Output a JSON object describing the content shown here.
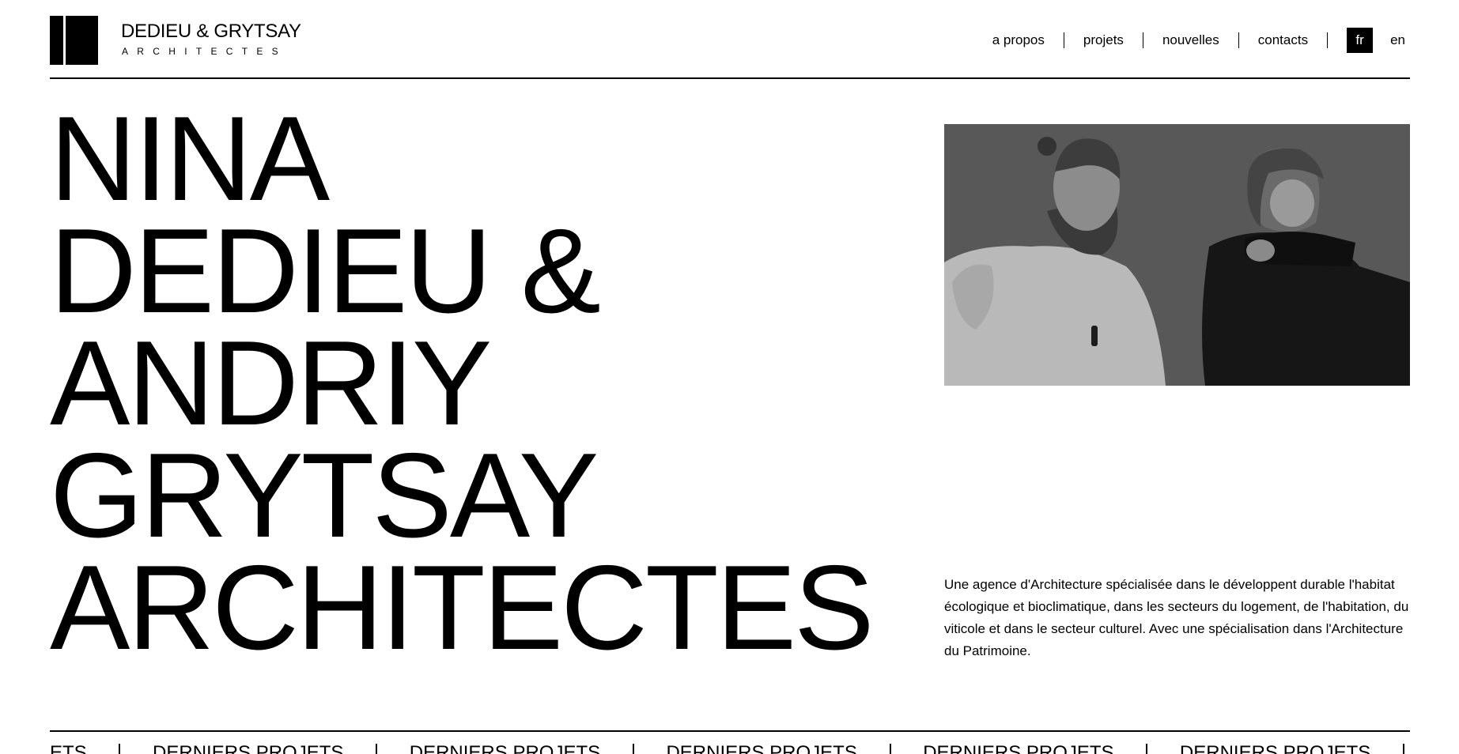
{
  "brand": {
    "name": "DEDIEU & GRYTSAY",
    "subtitle": "ARCHITECTES"
  },
  "nav": {
    "items": [
      "a propos",
      "projets",
      "nouvelles",
      "contacts"
    ],
    "languages": [
      "fr",
      "en"
    ],
    "active_language": "fr"
  },
  "hero": {
    "title_lines": [
      "NINA",
      "DEDIEU &",
      "ANDRIY",
      "GRYTSAY",
      "ARCHITECTES"
    ]
  },
  "about": {
    "text": "Une agence d'Architecture spécialisée dans le développent durable l'habitat écologique et bioclimatique, dans les secteurs du logement, de l'habitation, du viticole et dans le secteur culturel. Avec une spécialisation dans l'Architecture du Patrimoine."
  },
  "ticker": {
    "label": "DERNIERS PROJETS",
    "leading_fragment": "ETS"
  }
}
